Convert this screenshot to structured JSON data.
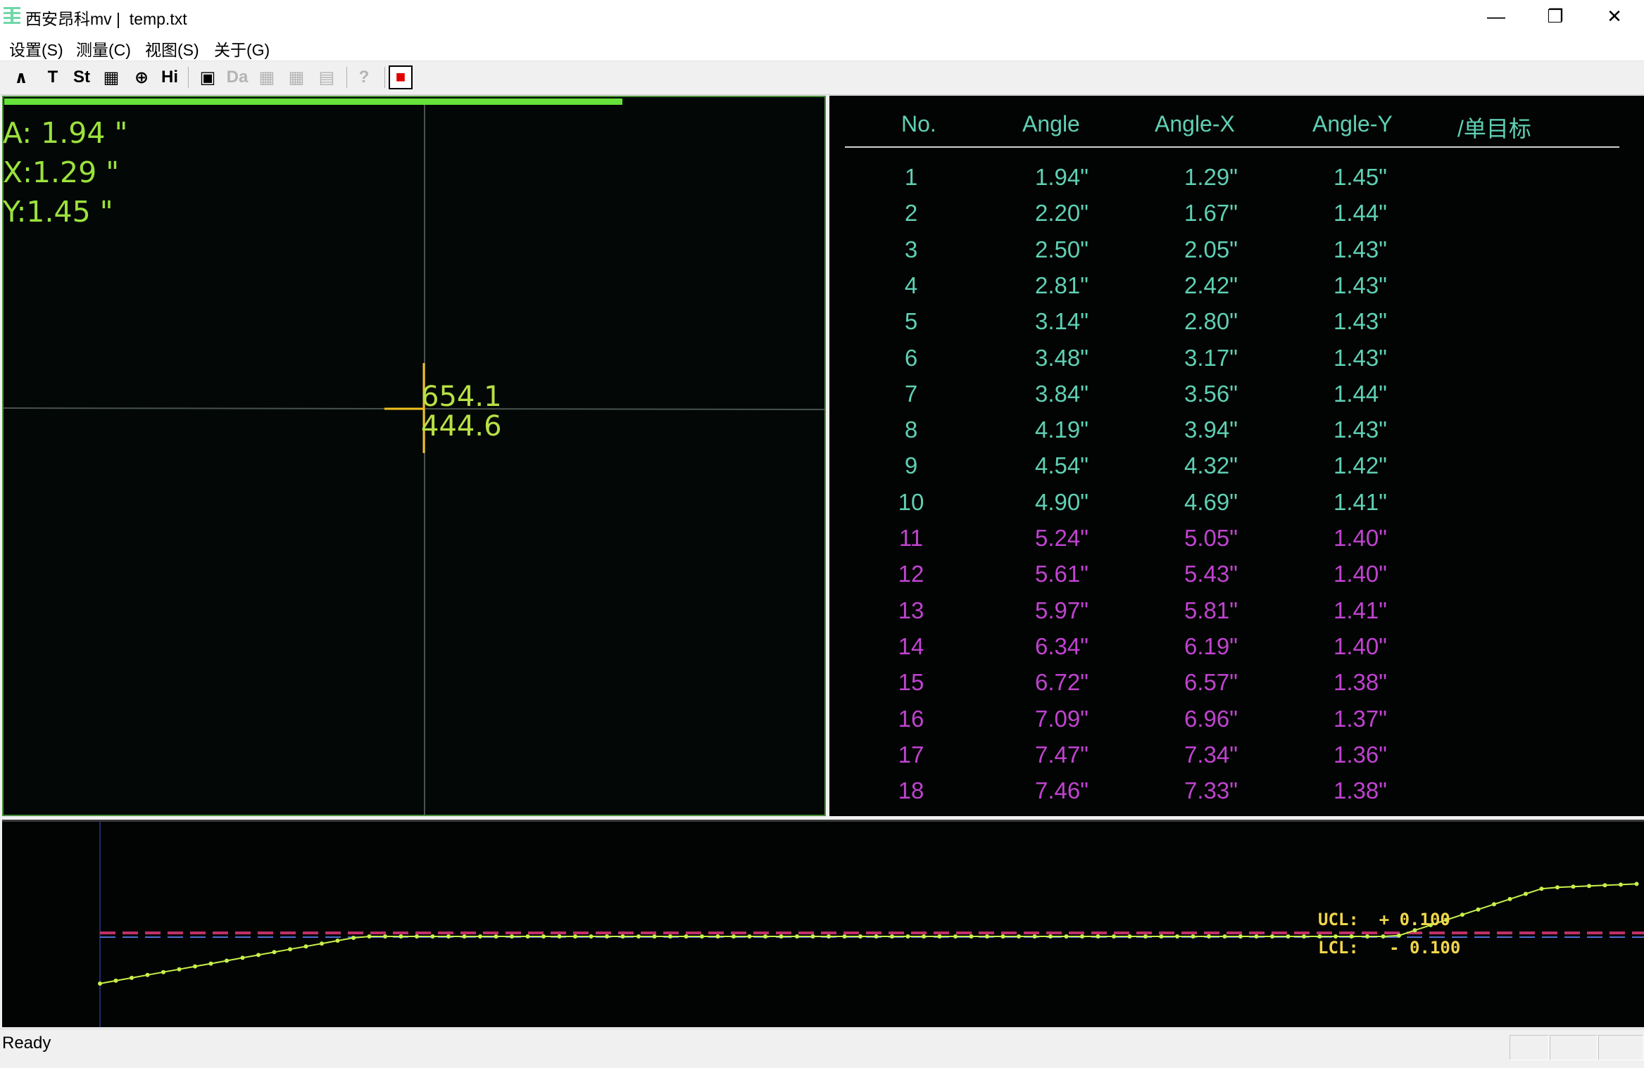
{
  "window": {
    "title": "西安昂科mv |  temp.txt",
    "minimize_glyph": "—",
    "restore_glyph": "❐",
    "close_glyph": "✕"
  },
  "menu": [
    {
      "label": "设置(S)"
    },
    {
      "label": "测量(C)"
    },
    {
      "label": "视图(S)"
    },
    {
      "label": "关于(G)"
    }
  ],
  "toolbar": {
    "buttons": [
      {
        "icon": "waveform-icon",
        "glyph": "∧",
        "enabled": true
      },
      {
        "icon": "text-tool-icon",
        "glyph": "T",
        "enabled": true
      },
      {
        "icon": "statistics-icon",
        "glyph": "St",
        "enabled": true
      },
      {
        "icon": "grid-icon",
        "glyph": "▦",
        "enabled": true
      },
      {
        "icon": "target-icon",
        "glyph": "⊕",
        "enabled": true
      },
      {
        "icon": "histogram-icon",
        "glyph": "Hi",
        "enabled": true
      },
      {
        "icon": "image-select-icon",
        "glyph": "▣",
        "enabled": true
      },
      {
        "icon": "data-icon",
        "glyph": "Da",
        "enabled": false
      },
      {
        "icon": "layout-icon",
        "glyph": "▦",
        "enabled": false
      },
      {
        "icon": "tile-icon",
        "glyph": "▦",
        "enabled": false
      },
      {
        "icon": "document-icon",
        "glyph": "▤",
        "enabled": false
      },
      {
        "icon": "help-icon",
        "glyph": "?",
        "enabled": false
      },
      {
        "icon": "stop-icon",
        "glyph": "■",
        "enabled": true
      }
    ]
  },
  "readout": {
    "angle": "A: 1.94 \"",
    "x": "X:1.29 \"",
    "y": "Y:1.45 \"",
    "coord_x": "654.1",
    "coord_y": "444.6",
    "progress_fraction": 0.75
  },
  "table": {
    "headers": [
      "No.",
      "Angle",
      "Angle-X",
      "Angle-Y",
      "/单目标"
    ],
    "rows": [
      [
        "1",
        "1.94\"",
        "1.29\"",
        "1.45\""
      ],
      [
        "2",
        "2.20\"",
        "1.67\"",
        "1.44\""
      ],
      [
        "3",
        "2.50\"",
        "2.05\"",
        "1.43\""
      ],
      [
        "4",
        "2.81\"",
        "2.42\"",
        "1.43\""
      ],
      [
        "5",
        "3.14\"",
        "2.80\"",
        "1.43\""
      ],
      [
        "6",
        "3.48\"",
        "3.17\"",
        "1.43\""
      ],
      [
        "7",
        "3.84\"",
        "3.56\"",
        "1.44\""
      ],
      [
        "8",
        "4.19\"",
        "3.94\"",
        "1.43\""
      ],
      [
        "9",
        "4.54\"",
        "4.32\"",
        "1.42\""
      ],
      [
        "10",
        "4.90\"",
        "4.69\"",
        "1.41\""
      ],
      [
        "11",
        "5.24\"",
        "5.05\"",
        "1.40\""
      ],
      [
        "12",
        "5.61\"",
        "5.43\"",
        "1.40\""
      ],
      [
        "13",
        "5.97\"",
        "5.81\"",
        "1.41\""
      ],
      [
        "14",
        "6.34\"",
        "6.19\"",
        "1.40\""
      ],
      [
        "15",
        "6.72\"",
        "6.57\"",
        "1.38\""
      ],
      [
        "16",
        "7.09\"",
        "6.96\"",
        "1.37\""
      ],
      [
        "17",
        "7.47\"",
        "7.34\"",
        "1.36\""
      ],
      [
        "18",
        "7.46\"",
        "7.33\"",
        "1.38\""
      ]
    ],
    "color_normal": "#5fd0b4",
    "color_highlight": "#c043d0",
    "highlight_from_row": 11
  },
  "trend": {
    "ucl_label": "UCL:  + 0.100",
    "lcl_label": "LCL:   - 0.100",
    "ucl_color": "#c0306a",
    "limit_line_color": "#4a70d0",
    "trace_color": "#c8f04a"
  },
  "status": {
    "text": "Ready"
  }
}
